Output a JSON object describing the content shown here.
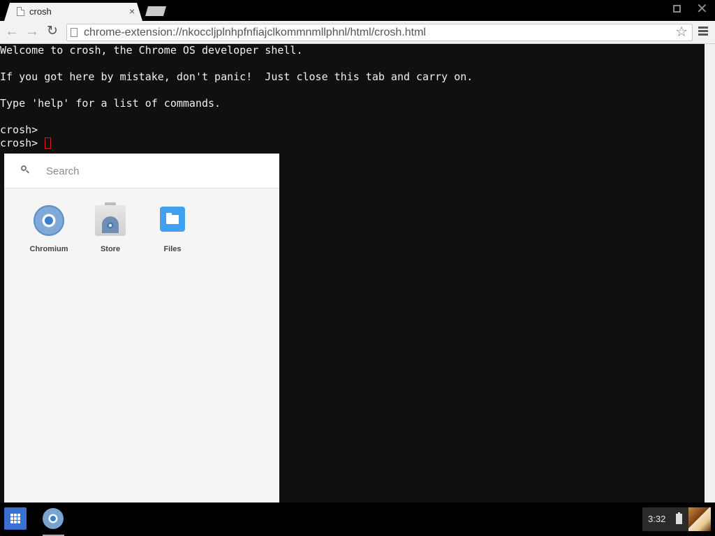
{
  "browser": {
    "tab": {
      "title": "crosh",
      "close_label": "×"
    },
    "url": "chrome-extension://nkoccljplnhpfnfiajclkommnmllphnl/html/crosh.html",
    "icons": {
      "back": "back-arrow-icon",
      "forward": "forward-arrow-icon",
      "reload": "reload-icon",
      "star": "star-icon",
      "menu": "menu-icon"
    }
  },
  "terminal": {
    "lines": [
      "Welcome to crosh, the Chrome OS developer shell.",
      "",
      "If you got here by mistake, don't panic!  Just close this tab and carry on.",
      "",
      "Type 'help' for a list of commands.",
      "",
      "crosh>",
      "crosh> "
    ],
    "cursor_color": "#e01515"
  },
  "launcher": {
    "search": {
      "placeholder": "Search",
      "value": ""
    },
    "apps": [
      {
        "label": "Chromium",
        "icon": "chromium-icon"
      },
      {
        "label": "Store",
        "icon": "store-icon"
      },
      {
        "label": "Files",
        "icon": "files-icon"
      }
    ]
  },
  "shelf": {
    "clock": "3:32",
    "launcher_color": "#3b6fd4"
  }
}
